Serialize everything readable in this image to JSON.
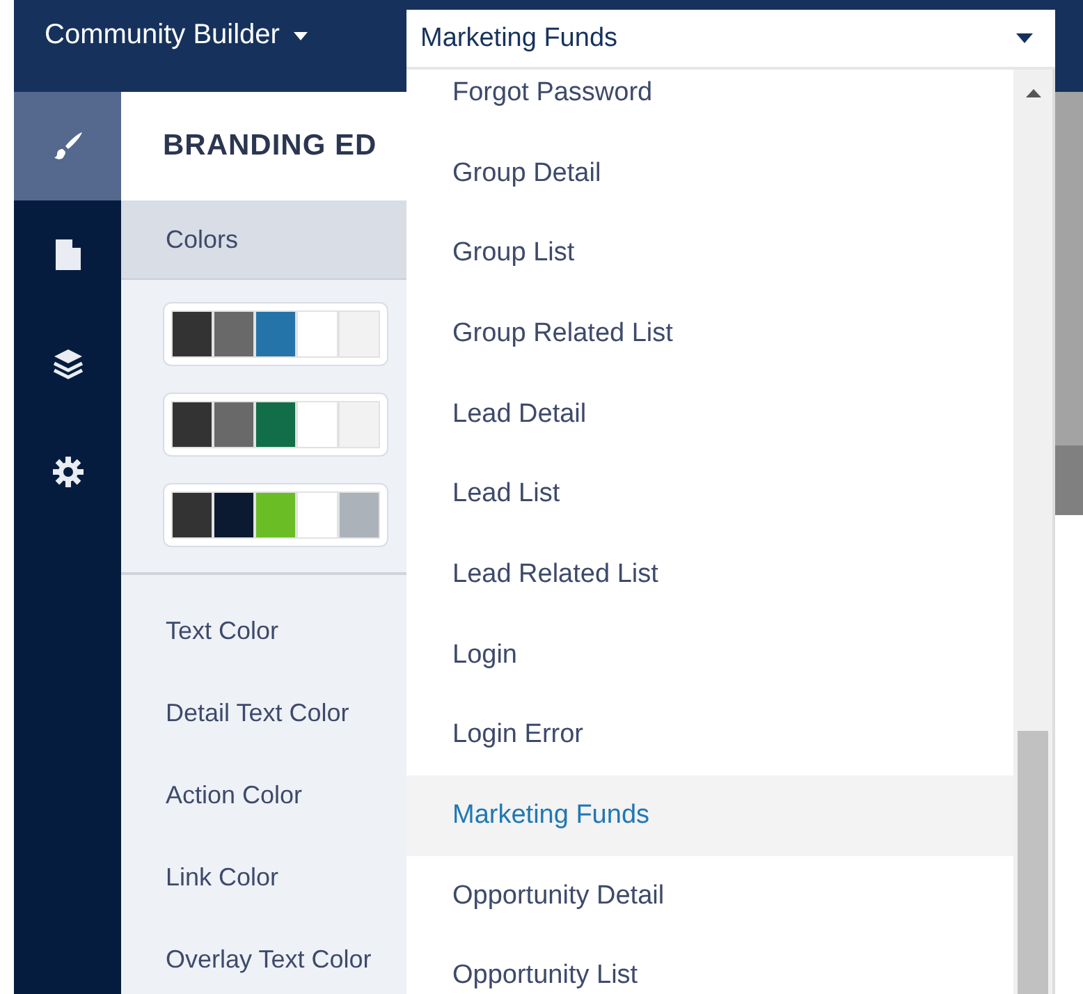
{
  "top_bar": {
    "title": "Community Builder"
  },
  "sidebar": {
    "items": [
      {
        "kind": "brush",
        "selected": true
      },
      {
        "kind": "page",
        "selected": false
      },
      {
        "kind": "layers",
        "selected": false
      },
      {
        "kind": "gear",
        "selected": false
      }
    ]
  },
  "panel": {
    "title": "BRANDING ED",
    "section": "Colors",
    "palettes": [
      {
        "swatches": [
          {
            "color": "#333333"
          },
          {
            "color": "#696969"
          },
          {
            "color": "#2574a9"
          },
          {
            "color": "#ffffff"
          },
          {
            "color": "#f2f2f2"
          }
        ]
      },
      {
        "swatches": [
          {
            "color": "#333333"
          },
          {
            "color": "#696969"
          },
          {
            "color": "#116e48"
          },
          {
            "color": "#ffffff"
          },
          {
            "color": "#f2f2f2"
          }
        ]
      },
      {
        "swatches": [
          {
            "color": "#333333"
          },
          {
            "color": "#0b1a30"
          },
          {
            "color": "#6bbd26"
          },
          {
            "color": "#ffffff"
          },
          {
            "color": "#abb2ba"
          }
        ]
      }
    ],
    "color_fields": [
      {
        "label": "Text Color"
      },
      {
        "label": "Detail Text Color"
      },
      {
        "label": "Action Color"
      },
      {
        "label": "Link Color"
      },
      {
        "label": "Overlay Text Color"
      }
    ]
  },
  "page_dropdown": {
    "value": "Marketing Funds",
    "options": [
      {
        "label": "Forgot Password",
        "selected": false
      },
      {
        "label": "Group Detail",
        "selected": false
      },
      {
        "label": "Group List",
        "selected": false
      },
      {
        "label": "Group Related List",
        "selected": false
      },
      {
        "label": "Lead Detail",
        "selected": false
      },
      {
        "label": "Lead List",
        "selected": false
      },
      {
        "label": "Lead Related List",
        "selected": false
      },
      {
        "label": "Login",
        "selected": false
      },
      {
        "label": "Login Error",
        "selected": false
      },
      {
        "label": "Marketing Funds",
        "selected": true
      },
      {
        "label": "Opportunity Detail",
        "selected": false
      },
      {
        "label": "Opportunity List",
        "selected": false
      }
    ]
  }
}
